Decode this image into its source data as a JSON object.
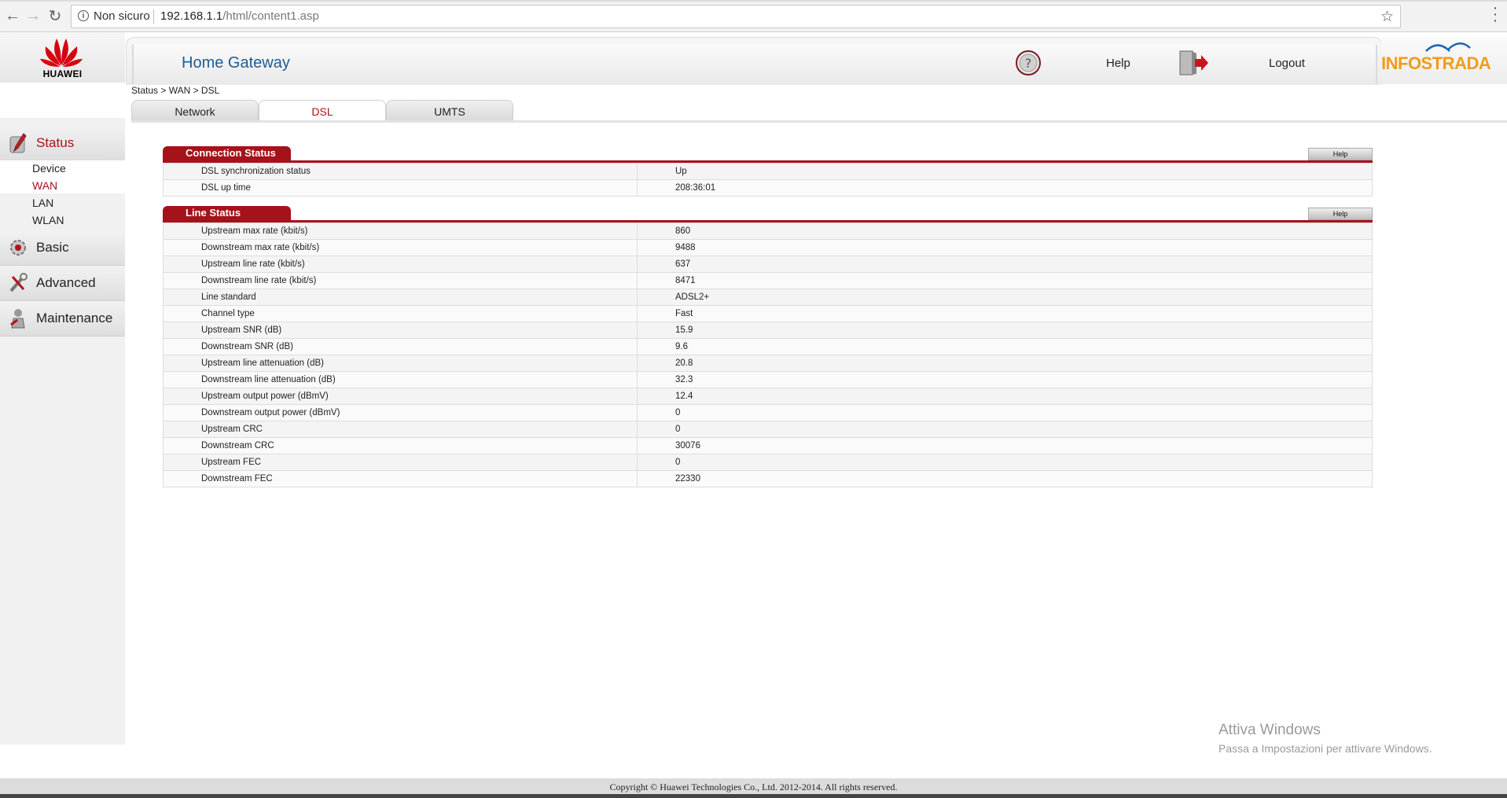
{
  "browser": {
    "security_label": "Non sicuro",
    "url_host": "192.168.1.1",
    "url_path": "/html/content1.asp"
  },
  "brand": {
    "name": "HUAWEI",
    "isp": "INFOSTRADA",
    "brand_color": "#a6121a",
    "isp_color": "#f29b1d"
  },
  "header": {
    "title": "Home Gateway",
    "help_label": "Help",
    "logout_label": "Logout"
  },
  "sidebar": {
    "menus": [
      {
        "label": "Status",
        "icon": "status-icon",
        "active": true
      },
      {
        "label": "Basic",
        "icon": "gear-icon",
        "active": false
      },
      {
        "label": "Advanced",
        "icon": "tools-icon",
        "active": false
      },
      {
        "label": "Maintenance",
        "icon": "wrench-person-icon",
        "active": false
      }
    ],
    "status_items": [
      "Device",
      "WAN",
      "LAN",
      "WLAN"
    ],
    "active_item": "WAN"
  },
  "breadcrumb": "Status > WAN > DSL",
  "tabs": [
    "Network",
    "DSL",
    "UMTS"
  ],
  "active_tab": "DSL",
  "connection_status": {
    "title": "Connection Status",
    "help_label": "Help",
    "rows": [
      [
        "DSL synchronization status",
        "Up"
      ],
      [
        "DSL up time",
        "208:36:01"
      ]
    ]
  },
  "line_status": {
    "title": "Line Status",
    "help_label": "Help",
    "rows": [
      [
        "Upstream max rate (kbit/s)",
        "860"
      ],
      [
        "Downstream max rate (kbit/s)",
        "9488"
      ],
      [
        "Upstream line rate (kbit/s)",
        "637"
      ],
      [
        "Downstream line rate (kbit/s)",
        "8471"
      ],
      [
        "Line standard",
        "ADSL2+"
      ],
      [
        "Channel type",
        "Fast"
      ],
      [
        "Upstream SNR (dB)",
        "15.9"
      ],
      [
        "Downstream SNR (dB)",
        "9.6"
      ],
      [
        "Upstream line attenuation (dB)",
        "20.8"
      ],
      [
        "Downstream line attenuation (dB)",
        "32.3"
      ],
      [
        "Upstream output power (dBmV)",
        "12.4"
      ],
      [
        "Downstream output power (dBmV)",
        "0"
      ],
      [
        "Upstream CRC",
        "0"
      ],
      [
        "Downstream CRC",
        "30076"
      ],
      [
        "Upstream FEC",
        "0"
      ],
      [
        "Downstream FEC",
        "22330"
      ]
    ]
  },
  "watermark": {
    "line1": "Attiva Windows",
    "line2": "Passa a Impostazioni per attivare Windows."
  },
  "footer": "Copyright © Huawei Technologies Co., Ltd. 2012-2014. All rights reserved."
}
